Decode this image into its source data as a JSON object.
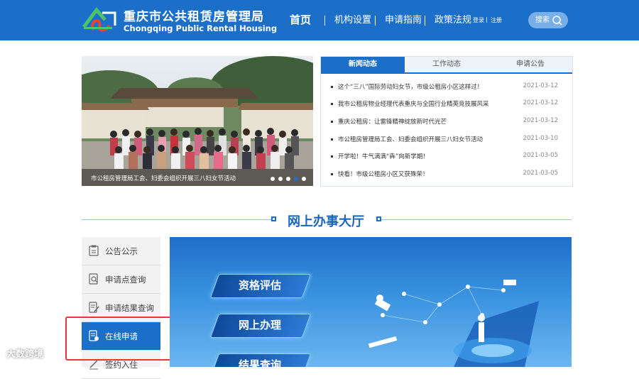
{
  "header": {
    "logo_cn": "重庆市公共租赁房管理局",
    "logo_en": "Chongqing Public Rental Housing",
    "nav": [
      "首页",
      "机构设置",
      "申请指南",
      "政策法规"
    ],
    "login": "登录",
    "register": "注册",
    "search_label": "搜索"
  },
  "carousel": {
    "caption": "市公租房管理局工会、妇委会组织开展三八妇女节活动",
    "slide_count": 5,
    "active_slide": 4
  },
  "news": {
    "tabs": [
      "新闻动态",
      "工作动态",
      "申请公告"
    ],
    "items": [
      {
        "title": "这个“三八”国际劳动妇女节，市级公租房小区这样过！",
        "date": "2021-03-12"
      },
      {
        "title": "我市公租房物业经理代表重庆与全国行业精英竞技展风采",
        "date": "2021-03-12"
      },
      {
        "title": "重庆公租房：让雷锋精神绽放新时代光芒",
        "date": "2021-03-12"
      },
      {
        "title": "市公租房管理局工会、妇委会组织开展三八妇女节活动",
        "date": "2021-03-10"
      },
      {
        "title": "开学啦！牛气满满“犇”向新学期！",
        "date": "2021-03-05"
      },
      {
        "title": "快看！市级公租房小区又获殊荣！",
        "date": "2021-03-05"
      }
    ]
  },
  "hall": {
    "title": "网上办事大厅",
    "menu": [
      "公告公示",
      "申请点查询",
      "申请结果查询",
      "在线申请",
      "签约入住"
    ],
    "buttons": [
      "资格评估",
      "网上办理",
      "结果查询"
    ]
  },
  "watermark": "大数跨境",
  "colors": {
    "primary": "#1c6fc8",
    "highlight": "#e23a3a"
  }
}
